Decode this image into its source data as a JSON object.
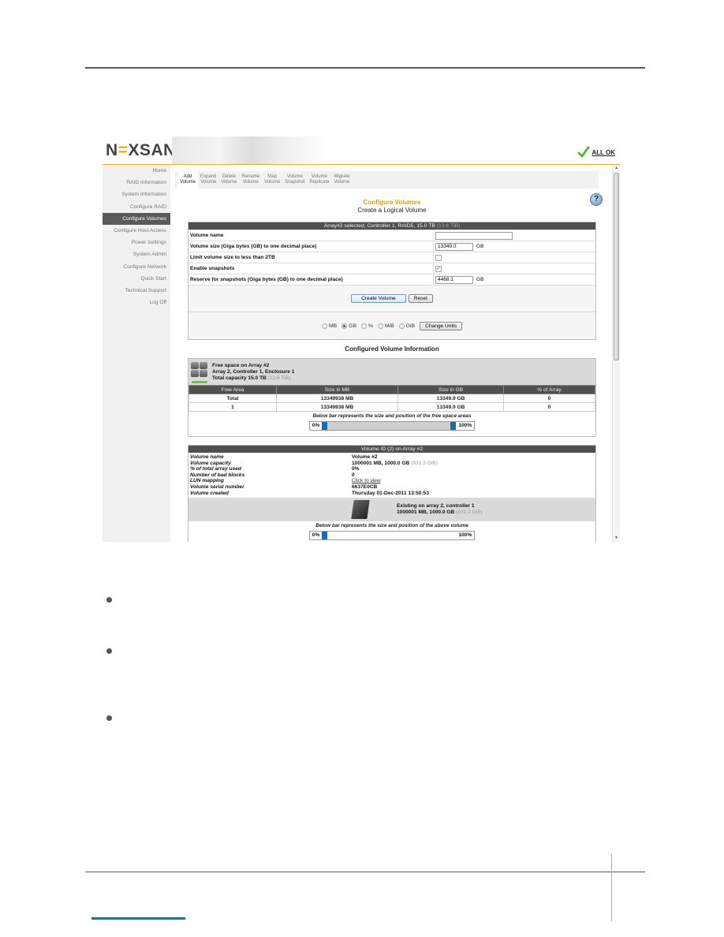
{
  "document": {
    "bullets": 3
  },
  "app": {
    "logo": "NEXSAN",
    "status_label": "ALL OK",
    "status_icon": "checkmark-icon",
    "help_icon": "help-icon"
  },
  "sidebar": {
    "items": [
      {
        "label": "Home",
        "active": false
      },
      {
        "label": "RAID Information",
        "active": false
      },
      {
        "label": "System Information",
        "active": false
      },
      {
        "label": "Configure RAID",
        "active": false
      },
      {
        "label": "Configure Volumes",
        "active": true
      },
      {
        "label": "Configure Host Access",
        "active": false
      },
      {
        "label": "Power Settings",
        "active": false
      },
      {
        "label": "System Admin",
        "active": false
      },
      {
        "label": "Configure Network",
        "active": false
      },
      {
        "label": "Quick Start",
        "active": false
      },
      {
        "label": "Technical Support",
        "active": false
      },
      {
        "label": "Log Off",
        "active": false
      }
    ]
  },
  "tabs": [
    {
      "line1": "Add",
      "line2": "Volume",
      "active": true
    },
    {
      "line1": "Expand",
      "line2": "Volume",
      "active": false
    },
    {
      "line1": "Delete",
      "line2": "Volume",
      "active": false
    },
    {
      "line1": "Rename",
      "line2": "Volume",
      "active": false
    },
    {
      "line1": "Map",
      "line2": "Volume",
      "active": false
    },
    {
      "line1": "Volume",
      "line2": "Snapshot",
      "active": false
    },
    {
      "line1": "Volume",
      "line2": "Replicate",
      "active": false
    },
    {
      "line1": "Migrate",
      "line2": "Volume",
      "active": false
    }
  ],
  "page": {
    "title": "Configure Volumes",
    "subtitle": "Create a Logical Volume"
  },
  "create_form": {
    "header": "Array#2 selected, Controller 1, RAID5, 15.0 TB",
    "header_muted": "(13.6 TiB)",
    "volume_name_label": "Volume name",
    "volume_name_value": "",
    "volume_size_label": "Volume size (Giga bytes (GB) to one decimal place)",
    "volume_size_value": "13349.0",
    "volume_size_unit": "GB",
    "limit_label": "Limit volume size to less than 2TB",
    "limit_checked": false,
    "snapshots_label": "Enable snapshots",
    "snapshots_checked": true,
    "reserve_label": "Reserve for snapshots (Giga bytes (GB) to one decimal place)",
    "reserve_value": "4468.1",
    "reserve_unit": "GB",
    "create_button": "Create Volume",
    "reset_button": "Reset",
    "units": [
      {
        "label": "MB",
        "selected": false
      },
      {
        "label": "GB",
        "selected": true
      },
      {
        "label": "%",
        "selected": false
      },
      {
        "label": "MiB",
        "selected": false
      },
      {
        "label": "GiB",
        "selected": false
      }
    ],
    "change_units_button": "Change Units"
  },
  "configured": {
    "title": "Configured Volume Information",
    "free_space": {
      "line1": "Free space on Array #2",
      "line2": "Array 2, Controller 1, Enclosure 1",
      "line3": "Total capacity 15.0 TB",
      "line3_muted": "(13.6 TiB)",
      "columns": [
        "Free Area",
        "Size in MB",
        "Size in GB",
        "% of Array"
      ],
      "rows": [
        [
          "Total",
          "13349938 MB",
          "13349.9 GB",
          "0"
        ],
        [
          "1",
          "13349938 MB",
          "13349.9 GB",
          "0"
        ]
      ],
      "bar_caption": "Below bar represents the size and position of the free space areas",
      "bar_start": "0%",
      "bar_end": "100%"
    },
    "volume": {
      "header": "Volume ID (2) on Array #2",
      "keys": [
        "Volume name",
        "Volume capacity",
        "% of total array used",
        "Number of bad blocks",
        "LUN mapping",
        "Volume serial number",
        "Volume created"
      ],
      "name": "Volume #2",
      "capacity": "1000001 MB, 1000.0 GB",
      "capacity_muted": "(931.3 GiB)",
      "pct_used": "0%",
      "bad_blocks": "0",
      "lun_mapping_link": "Click to view",
      "serial": "6637E0CB",
      "created": "Thursday 01-Dec-2011 13:50:53",
      "existing_line1": "Existing on array 2, controller 1",
      "existing_line2": "1000001 MB, 1000.0 GB",
      "existing_line2_muted": "(931.3 GiB)",
      "bar_caption": "Below bar represents the size and position of the above volume",
      "bar_start": "0%",
      "bar_end": "100%"
    }
  }
}
